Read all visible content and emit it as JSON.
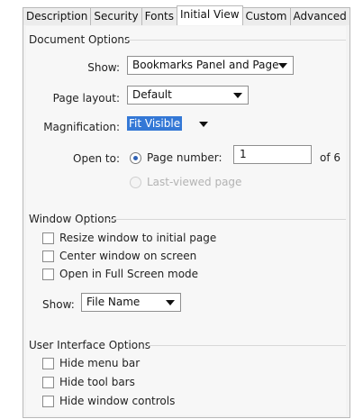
{
  "tabs": [
    {
      "label": "Description"
    },
    {
      "label": "Security"
    },
    {
      "label": "Fonts"
    },
    {
      "label": "Initial View"
    },
    {
      "label": "Custom"
    },
    {
      "label": "Advanced"
    }
  ],
  "document_options": {
    "title": "Document Options",
    "show_label": "Show:",
    "show_value": "Bookmarks Panel and Page",
    "page_layout_label": "Page layout:",
    "page_layout_value": "Default",
    "magnification_label": "Magnification:",
    "magnification_value": "Fit Visible",
    "open_to_label": "Open to:",
    "page_number_label": "Page number:",
    "page_number_value": "1",
    "page_total": "of 6",
    "last_viewed_label": "Last-viewed page"
  },
  "window_options": {
    "title": "Window Options",
    "resize_label": "Resize window to initial page",
    "center_label": "Center window on screen",
    "fullscreen_label": "Open in Full Screen mode",
    "show_label": "Show:",
    "show_value": "File Name"
  },
  "ui_options": {
    "title": "User Interface Options",
    "hide_menu_label": "Hide menu bar",
    "hide_tool_label": "Hide tool bars",
    "hide_window_label": "Hide window controls"
  }
}
